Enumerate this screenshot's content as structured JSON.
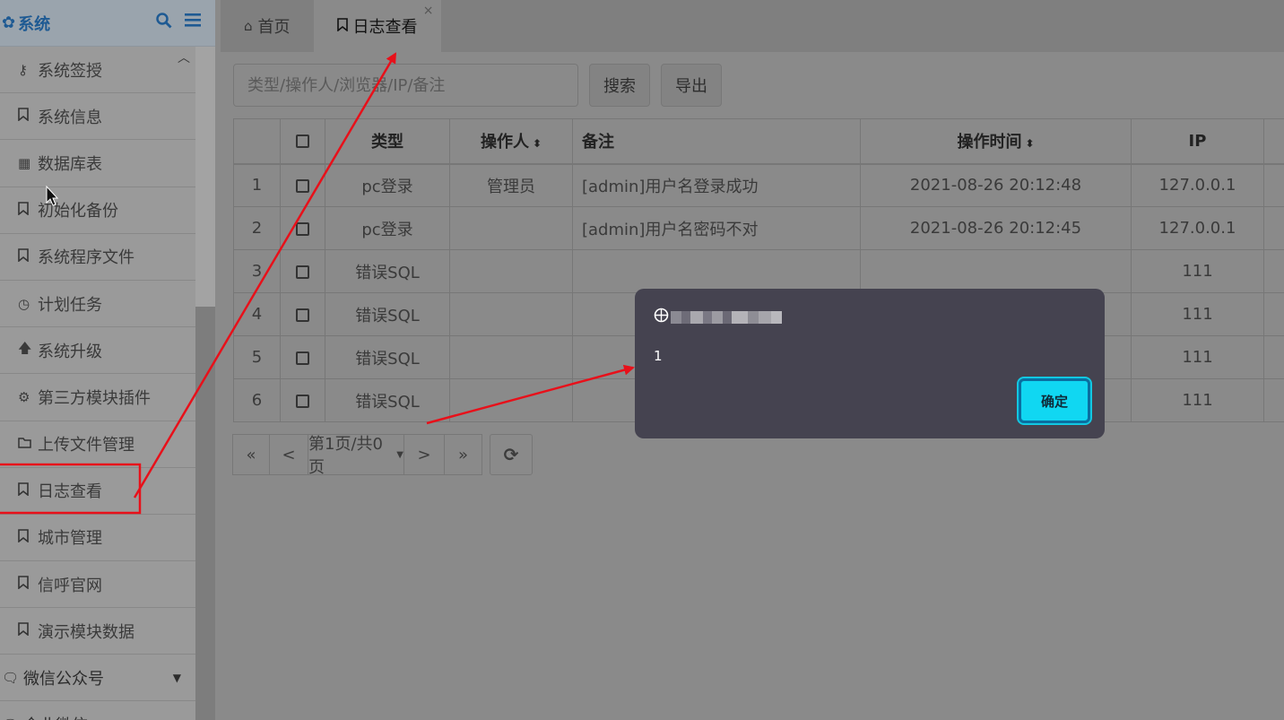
{
  "sidebar": {
    "title": "系统",
    "title_icon": "gear-icon",
    "items": [
      {
        "label": "系统签授",
        "icon": "key-icon"
      },
      {
        "label": "系统信息",
        "icon": "bookmark-icon"
      },
      {
        "label": "数据库表",
        "icon": "table-icon"
      },
      {
        "label": "初始化备份",
        "icon": "bookmark-icon"
      },
      {
        "label": "系统程序文件",
        "icon": "bookmark-icon"
      },
      {
        "label": "计划任务",
        "icon": "clock-icon"
      },
      {
        "label": "系统升级",
        "icon": "arrow-up-icon"
      },
      {
        "label": "第三方模块插件",
        "icon": "cogs-icon"
      },
      {
        "label": "上传文件管理",
        "icon": "folder-icon"
      },
      {
        "label": "日志查看",
        "icon": "bookmark-icon"
      },
      {
        "label": "城市管理",
        "icon": "bookmark-icon"
      },
      {
        "label": "信呼官网",
        "icon": "bookmark-icon"
      },
      {
        "label": "演示模块数据",
        "icon": "bookmark-icon"
      }
    ],
    "groups": [
      {
        "label": "微信公众号",
        "icon": "chat-icon"
      },
      {
        "label": "企业微信",
        "icon": "chat-icon"
      }
    ]
  },
  "tabs": [
    {
      "label": "首页",
      "icon": "home-icon"
    },
    {
      "label": "日志查看",
      "icon": "bookmark-icon"
    }
  ],
  "toolbar": {
    "search_placeholder": "类型/操作人/浏览器/IP/备注",
    "search_label": "搜索",
    "export_label": "导出"
  },
  "table": {
    "headers": [
      "类型",
      "操作人",
      "备注",
      "操作时间",
      "IP"
    ],
    "rows": [
      {
        "n": "1",
        "type": "pc登录",
        "op": "管理员",
        "note": "[admin]用户名登录成功",
        "time": "2021-08-26 20:12:48",
        "ip": "127.0.0.1"
      },
      {
        "n": "2",
        "type": "pc登录",
        "op": "",
        "note": "[admin]用户名密码不对",
        "time": "2021-08-26 20:12:45",
        "ip": "127.0.0.1"
      },
      {
        "n": "3",
        "type": "错误SQL",
        "op": "",
        "note": "",
        "time": "",
        "ip": "111"
      },
      {
        "n": "4",
        "type": "错误SQL",
        "op": "",
        "note": "",
        "time": "",
        "ip": "111"
      },
      {
        "n": "5",
        "type": "错误SQL",
        "op": "",
        "note": "",
        "time": "",
        "ip": "111"
      },
      {
        "n": "6",
        "type": "错误SQL",
        "op": "",
        "note": "",
        "time": "",
        "ip": "111"
      }
    ]
  },
  "pager": {
    "first": "«",
    "prev": "<",
    "page_info": "第1页/共0页",
    "next": ">",
    "last": "»"
  },
  "dialog": {
    "message": "1",
    "ok_label": "确定"
  },
  "colors": {
    "dialog_bg": "#454350",
    "ok_button": "#10d7f2",
    "annotation": "#e8101a"
  }
}
